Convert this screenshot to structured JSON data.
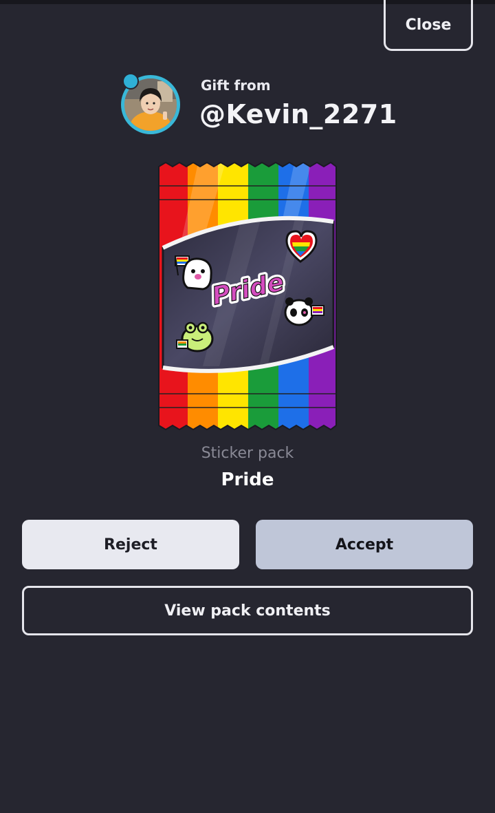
{
  "header": {
    "close_label": "Close"
  },
  "gift": {
    "label": "Gift from",
    "username": "@Kevin_2271",
    "avatar_icon": "user-avatar-icon"
  },
  "pack": {
    "type_label": "Sticker pack",
    "name": "Pride",
    "art_text": "Pride",
    "stripe_colors": [
      "#e8141c",
      "#ff8c00",
      "#ffe500",
      "#1a9c3a",
      "#1e6fe8",
      "#8a1fb8"
    ],
    "stickers": [
      "ghost-pride-flag-sticker",
      "rainbow-heart-sticker",
      "pride-text-sticker",
      "panda-pride-flag-sticker",
      "frog-pride-flag-sticker"
    ]
  },
  "actions": {
    "reject_label": "Reject",
    "accept_label": "Accept",
    "view_contents_label": "View pack contents"
  },
  "colors": {
    "background": "#262630",
    "accept_button": "#bfc6d8",
    "reject_button": "#e8e9f0",
    "avatar_ring": "#39b8d8"
  }
}
